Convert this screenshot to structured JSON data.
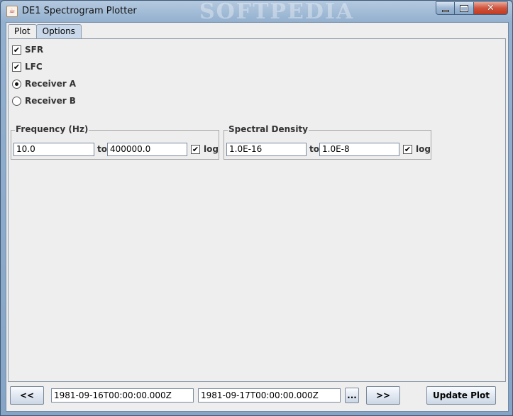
{
  "window": {
    "title": "DE1 Spectrogram Plotter",
    "watermark": "SOFTPEDIA"
  },
  "tabs": [
    {
      "label": "Plot",
      "selected": false
    },
    {
      "label": "Options",
      "selected": true
    }
  ],
  "options": {
    "sfr": {
      "label": "SFR",
      "checked": true
    },
    "lfc": {
      "label": "LFC",
      "checked": true
    },
    "receiver_a": {
      "label": "Receiver A",
      "selected": true
    },
    "receiver_b": {
      "label": "Receiver B",
      "selected": false
    },
    "check_mark": "✔"
  },
  "frequency": {
    "title": "Frequency (Hz)",
    "from": "10.0",
    "to_label": "to",
    "to": "400000.0",
    "log_label": "log",
    "log_checked": true
  },
  "spectral_density": {
    "title": "Spectral Density",
    "from": "1.0E-16",
    "to_label": "to",
    "to": "1.0E-8",
    "log_label": "log",
    "log_checked": true
  },
  "bottom": {
    "prev_label": "<<",
    "start_time": "1981-09-16T00:00:00.000Z",
    "end_time": "1981-09-17T00:00:00.000Z",
    "browse_label": "...",
    "next_label": ">>",
    "update_label": "Update Plot"
  },
  "icons": {
    "app": "java-cup-icon",
    "minimize": "minimize-icon",
    "maximize": "maximize-icon",
    "close": "close-icon"
  }
}
